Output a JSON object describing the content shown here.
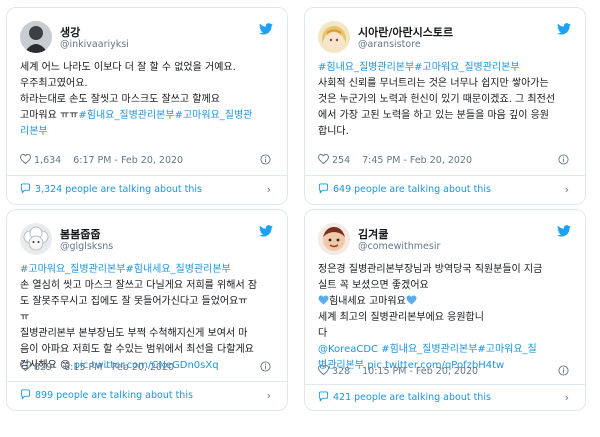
{
  "accent_color": "#1b95e0",
  "tweets": [
    {
      "name": "생강",
      "handle": "@inkivaariyksi",
      "avatar": "dark-figure-avatar",
      "body_text": "세계 어느 나라도 이보다 더 잘 할 수 없었을 거예요.\n우주최고였어요.\n하라는대로 손도 잘씻고 마스크도 잘쓰고 할께요\n고마워요 ㅠㅠ",
      "hashtags": "#힘내요_질병관리본부#고마워요_질병관\n리본부",
      "likes": "1,634",
      "time": "6:17 PM - Feb 20, 2020",
      "talking": "3,324 people are talking about this"
    },
    {
      "name": "시아란/아란시스토르",
      "handle": "@aransistore",
      "avatar": "anime-girl-avatar",
      "hashtags": "#힘내요_질병관리본부#고마워요_질병관리본부",
      "body_text": "사회적 신뢰를 무너트리는 것은 너무나 쉽지만 쌓아가는\n것은 누군가의 노력과 헌신이 있기 때문이겠죠. 그 최전선\n에서 가장 고된 노력을 하고 있는 분들을 마음 깊이 응원\n합니다.",
      "likes": "254",
      "time": "7:45 PM - Feb 20, 2020",
      "talking": "649 people are talking about this"
    },
    {
      "name": "봄봄줍줍",
      "handle": "@glglsksns",
      "avatar": "sheep-avatar",
      "hashtags": "#고마워요_질병관리본부#힘내세요_질병관리본부",
      "body_text": "손 열심히 씻고 마스크 잘쓰고 다닐게요 저희를 위해서 잠\n도 잘못주무시고 집에도 잘 못들어가신다고 들었어요ㅠ\nㅠ\n질병관리본부 본부장님도 부쩍 수척해지신게 보여서 마\n음이 아파요 저희도 할 수있는 범위에서 최선을 다할게요\n감사해요",
      "emoji": "😊",
      "link": "pic.twitter.com/CNeGDn0sXq",
      "likes": "829",
      "time": "8:15 PM - Feb 20, 2020",
      "talking": "899 people are talking about this"
    },
    {
      "name": "김겨쿨",
      "handle": "@comewithmesir",
      "avatar": "cartoon-face-avatar",
      "body_text": "정은경 질병관리본부장님과 방역당국 직원분들이 지금\n실트 꼭 보셨으면 좋겠어요",
      "cheer_line": "힘내세요 고마워요",
      "body_text_2": "세계 최고의 질병관리본부에요 응원합니\n다",
      "mention": "@KoreaCDC",
      "hashtags": "#힘내요_질병관리본부#고마워요_질\n병관리본부",
      "link": "pic.twitter.com/qPofzbH4tw",
      "likes": "328",
      "time": "10:15 PM - Feb 20, 2020",
      "talking": "421 people are talking about this"
    }
  ]
}
